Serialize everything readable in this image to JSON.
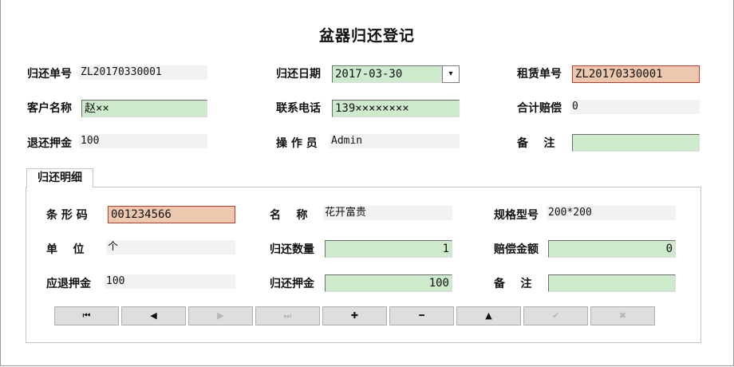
{
  "title": "盆器归还登记",
  "header": {
    "return_no_label": "归还单号",
    "return_no": "ZL20170330001",
    "return_date_label": "归还日期",
    "return_date": "2017-03-30",
    "rent_no_label": "租赁单号",
    "rent_no": "ZL20170330001",
    "customer_label": "客户名称",
    "customer": "赵××",
    "phone_label": "联系电话",
    "phone": "139××××××××",
    "total_comp_label": "合计赔偿",
    "total_comp": "0",
    "deposit_back_label": "退还押金",
    "deposit_back": "100",
    "operator_label": "操 作 员",
    "operator": "Admin",
    "remark_label": "备    注",
    "remark": ""
  },
  "detail": {
    "tab_label": "归还明细",
    "barcode_label": "条 形 码",
    "barcode": "001234566",
    "name_label": "名    称",
    "name": "花开富贵",
    "spec_label": "规格型号",
    "spec": "200*200",
    "unit_label": "单    位",
    "unit": "个",
    "qty_label": "归还数量",
    "qty": "1",
    "comp_amount_label": "赔偿金额",
    "comp_amount": "0",
    "deposit_due_label": "应退押金",
    "deposit_due": "100",
    "deposit_return_label": "归还押金",
    "deposit_return": "100",
    "remark_label": "备    注",
    "remark": ""
  },
  "nav": [
    "⏮",
    "◀",
    "▶",
    "⏭",
    "✚",
    "━",
    "▲",
    "✔",
    "✖"
  ],
  "icons": {
    "first": "first-record-icon",
    "prev": "previous-record-icon",
    "next": "next-record-icon",
    "last": "last-record-icon",
    "add": "add-icon",
    "delete": "delete-icon",
    "edit": "edit-icon",
    "save": "confirm-icon",
    "cancel": "cancel-icon"
  },
  "colors": {
    "input_green": "#cdeacd",
    "input_peach": "#ebc8ae",
    "readonly_bg": "#f2f2f2"
  }
}
